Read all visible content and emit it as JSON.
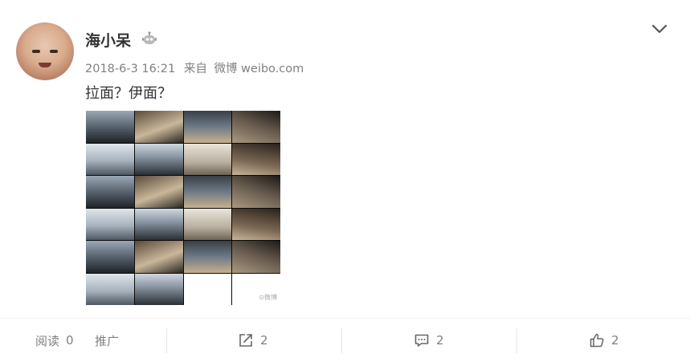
{
  "post": {
    "username": "海小呆",
    "timestamp": "2018-6-3 16:21",
    "source_prefix": "来自",
    "source_app": "微博 weibo.com",
    "text": "拉面？伊面？",
    "image_watermark": "⊙微博"
  },
  "footer": {
    "read_label": "阅读",
    "read_count": "0",
    "promote_label": "推广",
    "share_count": "2",
    "comment_count": "2",
    "like_count": "2"
  },
  "icons": {
    "vip": "vip-robot-icon",
    "menu": "chevron-down-icon",
    "share": "share-icon",
    "comment": "comment-icon",
    "like": "like-icon"
  },
  "colors": {
    "text": "#333333",
    "meta": "#808080",
    "divider": "#f0f0f0"
  }
}
